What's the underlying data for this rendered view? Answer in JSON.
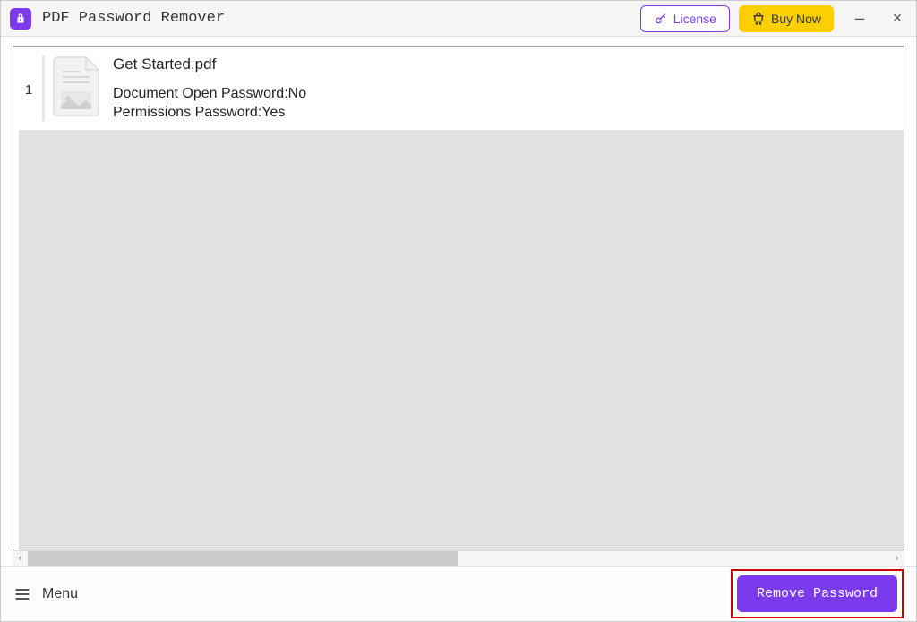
{
  "titlebar": {
    "app_name": "PDF Password Remover",
    "license_label": "License",
    "buy_label": "Buy Now",
    "minimize_symbol": "–",
    "close_symbol": "×"
  },
  "file_list": {
    "items": [
      {
        "index": "1",
        "filename": "Get Started.pdf",
        "open_password_label": "Document Open Password:",
        "open_password_value": "No",
        "permissions_password_label": "Permissions Password:",
        "permissions_password_value": "Yes"
      }
    ]
  },
  "scrollbar": {
    "left_arrow": "‹",
    "right_arrow": "›"
  },
  "footer": {
    "menu_label": "Menu",
    "remove_label": "Remove Password"
  },
  "colors": {
    "accent": "#7c3aed",
    "buy_button": "#fccf00",
    "highlight_border": "#cc0000"
  }
}
